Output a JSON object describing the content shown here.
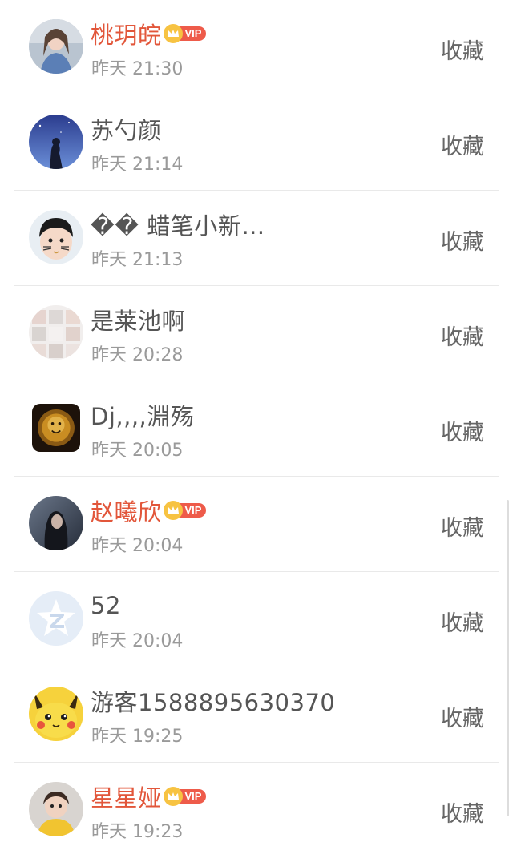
{
  "items": [
    {
      "name": "桃玥皖",
      "vip": true,
      "vip_label": "VIP",
      "time": "昨天 21:30",
      "action": "收藏",
      "avatar": "photo-girl-blue-icon"
    },
    {
      "name": "苏勺颜",
      "vip": false,
      "time": "昨天 21:14",
      "action": "收藏",
      "avatar": "photo-blue-night-icon"
    },
    {
      "name": "�� 蜡笔小新…",
      "vip": false,
      "time": "昨天 21:13",
      "action": "收藏",
      "avatar": "photo-cartoon-boy-icon"
    },
    {
      "name": "是莱池啊",
      "vip": false,
      "time": "昨天 20:28",
      "action": "收藏",
      "avatar": "photo-collage-icon"
    },
    {
      "name": "Dj,,,,淵殇",
      "vip": false,
      "time": "昨天 20:05",
      "action": "收藏",
      "avatar": "photo-gold-lion-icon"
    },
    {
      "name": "赵曦欣",
      "vip": true,
      "vip_label": "VIP",
      "time": "昨天 20:04",
      "action": "收藏",
      "avatar": "photo-dark-girl-icon"
    },
    {
      "name": "52",
      "vip": false,
      "time": "昨天 20:04",
      "action": "收藏",
      "avatar": "default-avatar-icon"
    },
    {
      "name": "游客1588895630370",
      "vip": false,
      "time": "昨天 19:25",
      "action": "收藏",
      "avatar": "pikachu-avatar-icon"
    },
    {
      "name": "星星娅",
      "vip": true,
      "vip_label": "VIP",
      "time": "昨天 19:23",
      "action": "收藏",
      "avatar": "photo-child-icon"
    }
  ]
}
